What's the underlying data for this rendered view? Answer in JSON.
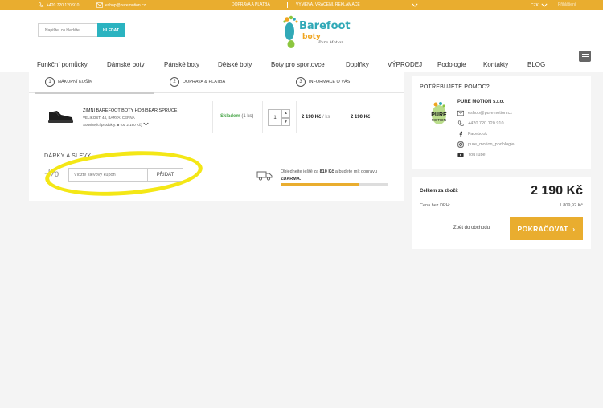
{
  "topbar": {
    "phone": "+420 720 120 910",
    "email": "eshop@puremotion.cz",
    "shipping": "DOPRAVA A PLATBA",
    "returns": "VÝMĚNA, VRÁCENÍ, REKLAMACE",
    "currency": "CZK",
    "login": "Přihlášení",
    "bg_color": "#e9ad2f"
  },
  "search": {
    "placeholder": "Napište, co hledáte",
    "button": "HLEDAT"
  },
  "logo": {
    "word1": "Barefoot",
    "word2": "boty",
    "word3": "Pure Motion"
  },
  "nav": {
    "items": [
      "Funkční pomůcky",
      "Dámské boty",
      "Pánské boty",
      "Dětské boty",
      "Boty pro sportovce",
      "Doplňky",
      "VÝPRODEJ",
      "Podologie",
      "Kontakty",
      "BLOG"
    ]
  },
  "steps": [
    {
      "num": "1",
      "label": "NÁKUPNÍ KOŠÍK"
    },
    {
      "num": "2",
      "label": "DOPRAVA & PLATBA"
    },
    {
      "num": "3",
      "label": "INFORMACE O VÁS"
    }
  ],
  "product": {
    "name": "ZIMNÍ BAREFOOT BOTY HOBIBEAR SPRUCE",
    "variant": "VELIKOST: 44, BARVA: ČERNÁ",
    "related_prefix": "Související produkty:",
    "related_count": "8",
    "related_suffix": "(od 2 190 Kč)",
    "stock": "Skladem",
    "stock_qty": "(1 ks)",
    "quantity": "1",
    "unit_price": "2 190 Kč",
    "unit": "/ ks",
    "total": "2 190 Kč"
  },
  "gifts": {
    "title": "DÁRKY A SLEVY",
    "percent": "-%",
    "placeholder": "Vložte slevový kupón",
    "add_button": "PŘIDAT"
  },
  "shipping_info": {
    "text_before": "Objednejte ještě za",
    "amount": "810 Kč",
    "text_after": "a budete mít dopravu",
    "free": "ZDARMA.",
    "progress": 0.73
  },
  "help": {
    "title": "POTŘEBUJETE POMOC?",
    "company": "PURE MOTION s.r.o.",
    "logo_text1": "PURE",
    "logo_text2": "MOTION",
    "email": "eshop@puremotion.cz",
    "phone": "+420 720 120 910",
    "facebook": "Facebook",
    "instagram": "pure_motion_podologie/",
    "youtube": "YouTube"
  },
  "summary": {
    "total_label": "Celkem za zboží:",
    "total_value": "2 190 Kč",
    "vat_label": "Cena bez DPH:",
    "vat_value": "1 809,92 Kč",
    "back": "Zpět do obchodu",
    "continue": "POKRAČOVAT"
  }
}
